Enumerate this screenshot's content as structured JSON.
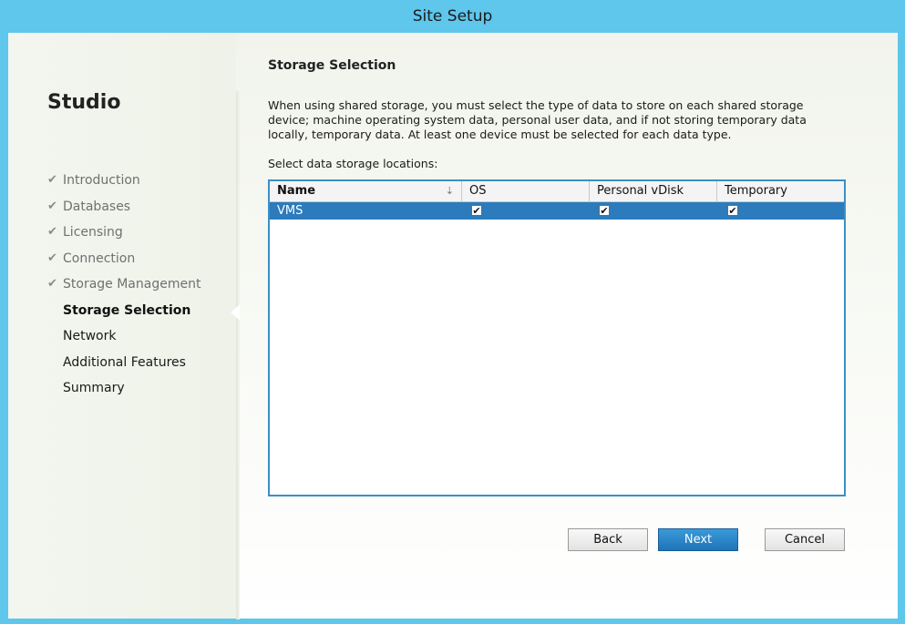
{
  "window": {
    "title": "Site Setup"
  },
  "sidebar": {
    "brand": "Studio",
    "steps": [
      {
        "label": "Introduction",
        "state": "done"
      },
      {
        "label": "Databases",
        "state": "done"
      },
      {
        "label": "Licensing",
        "state": "done"
      },
      {
        "label": "Connection",
        "state": "done"
      },
      {
        "label": "Storage Management",
        "state": "done"
      },
      {
        "label": "Storage Selection",
        "state": "current"
      },
      {
        "label": "Network",
        "state": "future"
      },
      {
        "label": "Additional Features",
        "state": "future"
      },
      {
        "label": "Summary",
        "state": "future"
      }
    ],
    "check_icon": "✔"
  },
  "main": {
    "title": "Storage Selection",
    "description": "When using shared storage, you must select the type of data to store on each shared storage device; machine operating system data, personal user data, and if not storing temporary data locally, temporary data. At least one device must be selected for each data type.",
    "list_label": "Select data storage locations:"
  },
  "grid": {
    "columns": [
      "Name",
      "OS",
      "Personal vDisk",
      "Temporary"
    ],
    "sort_icon": "sort-descending-icon",
    "rows": [
      {
        "name": "VMS",
        "os": true,
        "personal_vdisk": true,
        "temporary": true,
        "selected": true
      }
    ]
  },
  "buttons": {
    "back": "Back",
    "next": "Next",
    "cancel": "Cancel"
  },
  "colors": {
    "title_bar": "#5fc6ec",
    "selection": "#2b7bbd",
    "accent_border": "#3a8fc7"
  }
}
